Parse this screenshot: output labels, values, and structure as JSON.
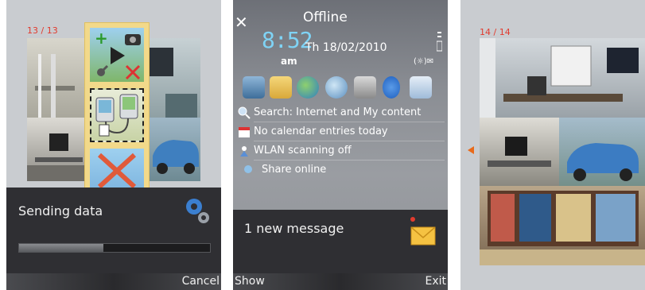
{
  "panel1": {
    "counter": "13 / 13",
    "dialog_title": "Sending data",
    "progress": 0.44,
    "softkey_right": "Cancel"
  },
  "panel2": {
    "profile": "Offline",
    "time": "8:52",
    "ampm": "am",
    "date": "Th 18/02/2010",
    "status_icons": "(☼)✉",
    "items": [
      {
        "icon": "search-icon",
        "text": "Search: Internet and My content"
      },
      {
        "icon": "calendar-icon",
        "text": "No calendar entries today"
      },
      {
        "icon": "wlan-icon",
        "text": "WLAN scanning off"
      },
      {
        "icon": "share-icon",
        "text": "Share online"
      }
    ],
    "message": "1 new message",
    "softkey_left": "Show",
    "softkey_right": "Exit"
  },
  "panel3": {
    "counter": "14 / 14"
  },
  "colors": {
    "accent_clock": "#7fd3f5",
    "counter_red": "#e23b2e",
    "dark_bar": "#2f2f33"
  }
}
